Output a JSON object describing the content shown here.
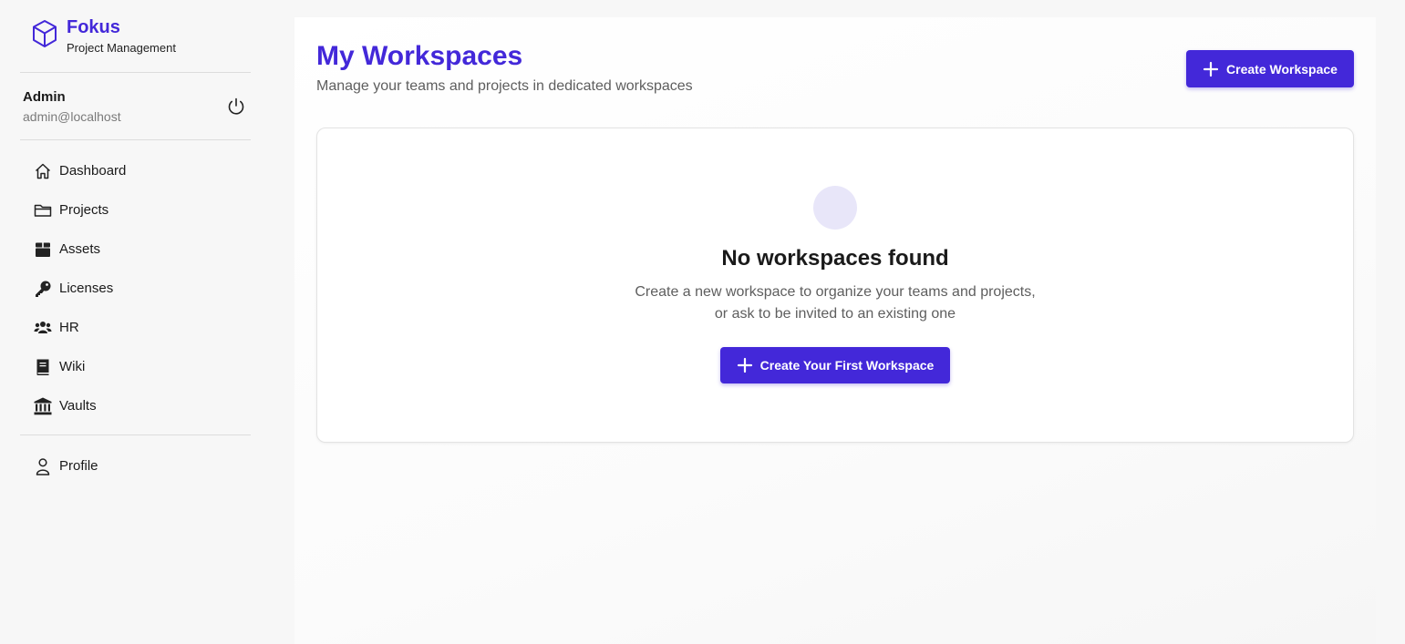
{
  "brand": {
    "name": "Fokus",
    "subtitle": "Project Management"
  },
  "user": {
    "name": "Admin",
    "email": "admin@localhost"
  },
  "nav": {
    "items": [
      {
        "label": "Dashboard",
        "icon": "home-icon"
      },
      {
        "label": "Projects",
        "icon": "folder-icon"
      },
      {
        "label": "Assets",
        "icon": "box-icon"
      },
      {
        "label": "Licenses",
        "icon": "key-icon"
      },
      {
        "label": "HR",
        "icon": "users-icon"
      },
      {
        "label": "Wiki",
        "icon": "book-icon"
      },
      {
        "label": "Vaults",
        "icon": "bank-icon"
      }
    ],
    "profile": {
      "label": "Profile",
      "icon": "user-icon"
    }
  },
  "main": {
    "title": "My Workspaces",
    "subtitle": "Manage your teams and projects in dedicated workspaces",
    "create_button": "Create Workspace"
  },
  "empty_state": {
    "title": "No workspaces found",
    "line1": "Create a new workspace to organize your teams and projects,",
    "line2": "or ask to be invited to an existing one",
    "button": "Create Your First Workspace"
  },
  "colors": {
    "accent": "#4328d9",
    "empty_circle": "#e8e6f9"
  }
}
